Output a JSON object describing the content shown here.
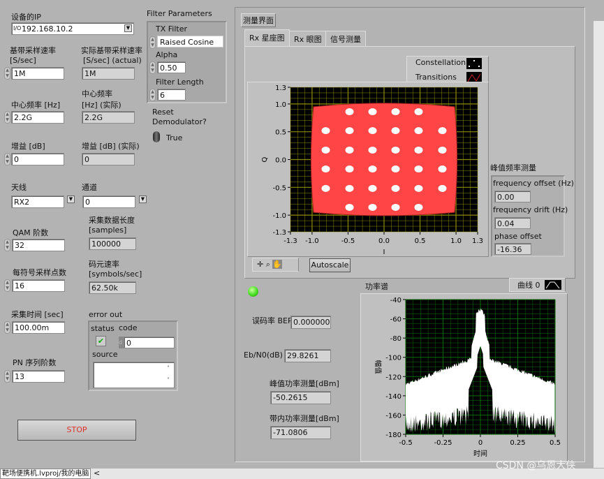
{
  "left": {
    "ip": {
      "label": "设备的IP",
      "value": "192.168.10.2"
    },
    "baseband_rate": {
      "label1": "基带采样速率",
      "label2": "[S/sec]",
      "value": "1M"
    },
    "baseband_rate_actual": {
      "label1": "实际基带采样速率",
      "label2": "[S/sec] (actual)",
      "value": "1M"
    },
    "center_freq": {
      "label": "中心频率 [Hz]",
      "value": "2.2G"
    },
    "center_freq_actual": {
      "label1": "中心频率",
      "label2": "[Hz] (实际)",
      "value": "2.2G"
    },
    "gain": {
      "label": "增益 [dB]",
      "value": "0"
    },
    "gain_actual": {
      "label": "增益 [dB] (实际)",
      "value": "0"
    },
    "antenna": {
      "label": "天线",
      "value": "RX2"
    },
    "channel": {
      "label": "通道",
      "value": "0"
    },
    "qam_order": {
      "label": "QAM 阶数",
      "value": "32"
    },
    "capture_length": {
      "label1": "采集数据长度",
      "label2": "[samples]",
      "value": "100000"
    },
    "samples_per_symbol": {
      "label": "每符号采样点数",
      "value": "16"
    },
    "symbol_rate": {
      "label1": "码元速率",
      "label2": "[symbols/sec]",
      "value": "62.50k"
    },
    "capture_time": {
      "label": "采集时间 [sec]",
      "value": "100.00m"
    },
    "pn_order": {
      "label": "PN 序列阶数",
      "value": "13"
    },
    "error_out": {
      "label": "error out",
      "status_label": "status",
      "code_label": "code",
      "code_value": "0",
      "code_prefix": "d",
      "source_label": "source",
      "source_value": ""
    },
    "stop_label": "STOP",
    "filter": {
      "title": "Filter Parameters",
      "tx_filter_label": "TX Filter",
      "tx_filter_value": "Raised Cosine",
      "alpha_label": "Alpha",
      "alpha_value": "0.50",
      "length_label": "Filter Length",
      "length_value": "6"
    },
    "reset": {
      "label1": "Reset",
      "label2": "Demodulator?",
      "state": "True"
    }
  },
  "main": {
    "section_label": "测量界面",
    "tabs": [
      {
        "label": "Rx 星座图",
        "active": true
      },
      {
        "label": "Rx 眼图"
      },
      {
        "label": "信号测量"
      }
    ],
    "constellation": {
      "legend": [
        {
          "name": "Constellation",
          "color": "#ffffff"
        },
        {
          "name": "Transitions",
          "color": "#ff4040"
        }
      ],
      "xlabel": "I",
      "ylabel": "Q",
      "xticks": [
        "-1.3",
        "-1.0",
        "-0.5",
        "0.0",
        "0.5",
        "1.0",
        "1.3"
      ],
      "yticks": [
        "1.3",
        "1.0",
        "0.5",
        "0.0",
        "-0.5",
        "-1.0",
        "-1.3"
      ],
      "range": [
        -1.3,
        1.3
      ],
      "points_i": [
        -0.81,
        -0.48,
        -0.16,
        0.16,
        0.48,
        0.81
      ],
      "points_q": [
        0.86,
        0.52,
        0.17,
        -0.17,
        -0.52,
        -0.86
      ],
      "autoscale_label": "Autoscale",
      "grid_color": "#8c8c00"
    },
    "peak_freq": {
      "title": "峰值频率测量",
      "freq_offset_label": "frequency offset (Hz)",
      "freq_offset_value": "0.00",
      "freq_drift_label": "frequency drift (Hz)",
      "freq_drift_value": "0.04",
      "phase_offset_label": "phase offset",
      "phase_offset_value": "-16.36"
    },
    "led_color": "#44dd22",
    "ber": {
      "label": "误码率 BER",
      "value": "0.000000"
    },
    "ebn0": {
      "label": "Eb/N0(dB)",
      "value": "29.8261"
    },
    "peak_power": {
      "label": "峰值功率测量[dBm]",
      "value": "-50.2615"
    },
    "inband_power": {
      "label": "带内功率测量[dBm]",
      "value": "-71.0806"
    },
    "spectrum": {
      "title": "功率谱",
      "legend": "曲线 0",
      "xlabel": "时间",
      "ylabel": "幅值",
      "xticks": [
        "-0.5",
        "-0.25",
        "0",
        "0.25",
        "0.5"
      ],
      "yticks": [
        "-40",
        "-60",
        "-80",
        "-100",
        "-120",
        "-140",
        "-160",
        "-180"
      ],
      "xlim": [
        -0.5,
        0.5
      ],
      "ylim": [
        -180,
        -40
      ],
      "grid_color": "#0b6b0b"
    }
  },
  "status_bar": {
    "path": "靶场便携机.lvproj/我的电脑",
    "scroll_left": "<"
  },
  "watermark": "CSDN @乌恩大侠"
}
